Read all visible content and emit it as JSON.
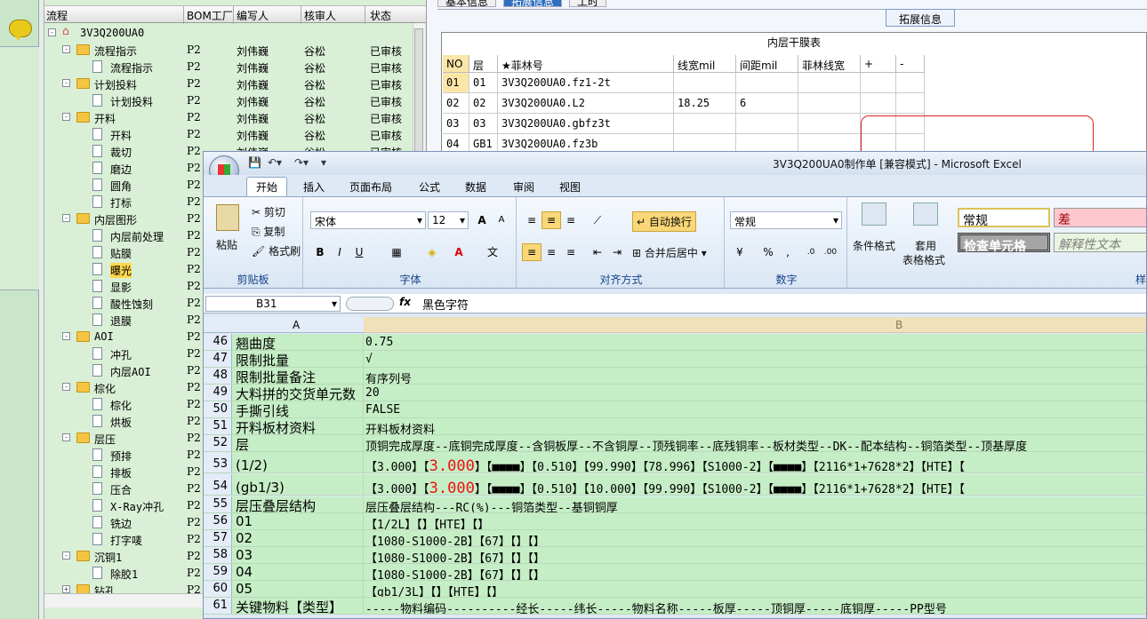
{
  "tree": {
    "headers": [
      "流程",
      "BOM工厂",
      "编写人",
      "核审人",
      "状态"
    ],
    "rows": [
      {
        "indent": 0,
        "type": "root",
        "exp": "-",
        "name": "3V3Q200UA0",
        "plant": "",
        "writer": "",
        "checker": "",
        "status": ""
      },
      {
        "indent": 1,
        "type": "folder",
        "exp": "-",
        "name": "流程指示",
        "plant": "P2",
        "writer": "刘伟巍",
        "checker": "谷松",
        "status": "已审核"
      },
      {
        "indent": 2,
        "type": "doc",
        "exp": "",
        "name": "流程指示",
        "plant": "P2",
        "writer": "刘伟巍",
        "checker": "谷松",
        "status": "已审核"
      },
      {
        "indent": 1,
        "type": "folder",
        "exp": "-",
        "name": "计划投料",
        "plant": "P2",
        "writer": "刘伟巍",
        "checker": "谷松",
        "status": "已审核"
      },
      {
        "indent": 2,
        "type": "doc",
        "exp": "",
        "name": "计划投料",
        "plant": "P2",
        "writer": "刘伟巍",
        "checker": "谷松",
        "status": "已审核"
      },
      {
        "indent": 1,
        "type": "folder",
        "exp": "-",
        "name": "开料",
        "plant": "P2",
        "writer": "刘伟巍",
        "checker": "谷松",
        "status": "已审核"
      },
      {
        "indent": 2,
        "type": "doc",
        "exp": "",
        "name": "开料",
        "plant": "P2",
        "writer": "刘伟巍",
        "checker": "谷松",
        "status": "已审核"
      },
      {
        "indent": 2,
        "type": "doc",
        "exp": "",
        "name": "裁切",
        "plant": "P2",
        "writer": "刘伟巍",
        "checker": "谷松",
        "status": "已审核"
      },
      {
        "indent": 2,
        "type": "doc",
        "exp": "",
        "name": "磨边",
        "plant": "P2",
        "writer": "",
        "checker": "",
        "status": ""
      },
      {
        "indent": 2,
        "type": "doc",
        "exp": "",
        "name": "圆角",
        "plant": "P2",
        "writer": "",
        "checker": "",
        "status": ""
      },
      {
        "indent": 2,
        "type": "doc",
        "exp": "",
        "name": "打标",
        "plant": "P2",
        "writer": "",
        "checker": "",
        "status": ""
      },
      {
        "indent": 1,
        "type": "folder",
        "exp": "-",
        "name": "内层图形",
        "plant": "P2",
        "writer": "",
        "checker": "",
        "status": ""
      },
      {
        "indent": 2,
        "type": "doc",
        "exp": "",
        "name": "内层前处理",
        "plant": "P2",
        "writer": "",
        "checker": "",
        "status": ""
      },
      {
        "indent": 2,
        "type": "doc",
        "exp": "",
        "name": "贴膜",
        "plant": "P2",
        "writer": "",
        "checker": "",
        "status": ""
      },
      {
        "indent": 2,
        "type": "doc",
        "exp": "",
        "name": "曝光",
        "plant": "P2",
        "writer": "",
        "checker": "",
        "status": "",
        "selected": true
      },
      {
        "indent": 2,
        "type": "doc",
        "exp": "",
        "name": "显影",
        "plant": "P2",
        "writer": "",
        "checker": "",
        "status": ""
      },
      {
        "indent": 2,
        "type": "doc",
        "exp": "",
        "name": "酸性蚀刻",
        "plant": "P2",
        "writer": "",
        "checker": "",
        "status": ""
      },
      {
        "indent": 2,
        "type": "doc",
        "exp": "",
        "name": "退膜",
        "plant": "P2",
        "writer": "",
        "checker": "",
        "status": ""
      },
      {
        "indent": 1,
        "type": "folder",
        "exp": "-",
        "name": "AOI",
        "plant": "P2",
        "writer": "",
        "checker": "",
        "status": ""
      },
      {
        "indent": 2,
        "type": "doc",
        "exp": "",
        "name": "冲孔",
        "plant": "P2",
        "writer": "",
        "checker": "",
        "status": ""
      },
      {
        "indent": 2,
        "type": "doc",
        "exp": "",
        "name": "内层AOI",
        "plant": "P2",
        "writer": "",
        "checker": "",
        "status": ""
      },
      {
        "indent": 1,
        "type": "folder",
        "exp": "-",
        "name": "棕化",
        "plant": "P2",
        "writer": "",
        "checker": "",
        "status": ""
      },
      {
        "indent": 2,
        "type": "doc",
        "exp": "",
        "name": "棕化",
        "plant": "P2",
        "writer": "",
        "checker": "",
        "status": ""
      },
      {
        "indent": 2,
        "type": "doc",
        "exp": "",
        "name": "烘板",
        "plant": "P2",
        "writer": "",
        "checker": "",
        "status": ""
      },
      {
        "indent": 1,
        "type": "folder",
        "exp": "-",
        "name": "层压",
        "plant": "P2",
        "writer": "",
        "checker": "",
        "status": ""
      },
      {
        "indent": 2,
        "type": "doc",
        "exp": "",
        "name": "预排",
        "plant": "P2",
        "writer": "",
        "checker": "",
        "status": ""
      },
      {
        "indent": 2,
        "type": "doc",
        "exp": "",
        "name": "排板",
        "plant": "P2",
        "writer": "",
        "checker": "",
        "status": ""
      },
      {
        "indent": 2,
        "type": "doc",
        "exp": "",
        "name": "压合",
        "plant": "P2",
        "writer": "",
        "checker": "",
        "status": ""
      },
      {
        "indent": 2,
        "type": "doc",
        "exp": "",
        "name": "X-Ray冲孔",
        "plant": "P2",
        "writer": "",
        "checker": "",
        "status": ""
      },
      {
        "indent": 2,
        "type": "doc",
        "exp": "",
        "name": "铣边",
        "plant": "P2",
        "writer": "",
        "checker": "",
        "status": ""
      },
      {
        "indent": 2,
        "type": "doc",
        "exp": "",
        "name": "打字唛",
        "plant": "P2",
        "writer": "",
        "checker": "",
        "status": ""
      },
      {
        "indent": 1,
        "type": "folder",
        "exp": "-",
        "name": "沉铜1",
        "plant": "P2",
        "writer": "",
        "checker": "",
        "status": ""
      },
      {
        "indent": 2,
        "type": "doc",
        "exp": "",
        "name": "除胶1",
        "plant": "P2",
        "writer": "",
        "checker": "",
        "status": ""
      },
      {
        "indent": 1,
        "type": "folder",
        "exp": "+",
        "name": "钻孔",
        "plant": "P2",
        "writer": "",
        "checker": "",
        "status": ""
      }
    ]
  },
  "panel": {
    "tabs": [
      "基本信息",
      "拓展信息",
      "工时"
    ],
    "group_button": "拓展信息",
    "table_caption": "内层干膜表",
    "columns": [
      "NO",
      "层",
      "★菲林号",
      "线宽mil",
      "间距mil",
      "菲林线宽",
      "+",
      "-"
    ],
    "rows": [
      [
        "01",
        "01",
        "3V3Q200UA0.fz1-2t",
        "",
        "",
        "",
        "",
        ""
      ],
      [
        "02",
        "02",
        "3V3Q200UA0.L2",
        "18.25",
        "6",
        "",
        "",
        ""
      ],
      [
        "03",
        "03",
        "3V3Q200UA0.gbfz3t",
        "",
        "",
        "",
        "",
        ""
      ],
      [
        "04",
        "GB1",
        "3V3Q200UA0.fz3b",
        "",
        "",
        "",
        "",
        ""
      ]
    ]
  },
  "excel": {
    "window_title": "3V3Q200UA0制作单  [兼容模式] - Microsoft Excel",
    "ribbon_tabs": [
      "开始",
      "插入",
      "页面布局",
      "公式",
      "数据",
      "审阅",
      "视图"
    ],
    "clipboard": {
      "paste": "粘贴",
      "cut": "剪切",
      "copy": "复制",
      "format_painter": "格式刷",
      "label": "剪贴板"
    },
    "font": {
      "name": "宋体",
      "size": "12",
      "label": "字体",
      "grow": "A",
      "shrink": "A"
    },
    "alignment": {
      "wrap": "自动换行",
      "merge": "合并后居中",
      "label": "对齐方式"
    },
    "number": {
      "format": "常规",
      "label": "数字"
    },
    "styles": {
      "conditional": "条件格式",
      "table": "套用",
      "table2": "表格格式",
      "normal": "常规",
      "bad": "差",
      "check": "检查单元格",
      "explain": "解释性文本",
      "label": "样"
    },
    "name_box": "B31",
    "formula_value": "黑色字符",
    "col_a": "A",
    "col_b": "B",
    "rows": [
      {
        "n": "46",
        "a": "翘曲度",
        "b": "0.75"
      },
      {
        "n": "47",
        "a": "限制批量",
        "b": "√"
      },
      {
        "n": "48",
        "a": "限制批量备注",
        "b": "有序列号"
      },
      {
        "n": "49",
        "a": "大料拼的交货单元数",
        "b": "20"
      },
      {
        "n": "50",
        "a": "手撕引线",
        "b": "FALSE"
      },
      {
        "n": "51",
        "a": "开料板材资料",
        "b": "开料板材资料"
      },
      {
        "n": "52",
        "a": "层",
        "b": "顶铜完成厚度--底铜完成厚度--含铜板厚--不含铜厚--顶残铜率--底残铜率--板材类型--DK--配本结构--铜箔类型--顶基厚度"
      },
      {
        "n": "53",
        "a": "(1/2)",
        "b1": "【3.000】【",
        "big": "3.000",
        "b2": "】【■■■■】【0.510】【99.990】【78.996】【S1000-2】【■■■■】【2116*1+7628*2】【HTE】【",
        "tall": true
      },
      {
        "n": "54",
        "a": "(gb1/3)",
        "b1": "【3.000】【",
        "big": "3.000",
        "b2": "】【■■■■】【0.510】【10.000】【99.990】【S1000-2】【■■■■】【2116*1+7628*2】【HTE】【",
        "tall": true
      },
      {
        "n": "55",
        "a": "层压叠层结构",
        "b": "层压叠层结构---RC(%)---铜箔类型--基铜铜厚"
      },
      {
        "n": "56",
        "a": "01",
        "b": "【1/2L】【】【HTE】【】"
      },
      {
        "n": "57",
        "a": "02",
        "b": "【1080-S1000-2B】【67】【】【】"
      },
      {
        "n": "58",
        "a": "03",
        "b": "【1080-S1000-2B】【67】【】【】"
      },
      {
        "n": "59",
        "a": "04",
        "b": "【1080-S1000-2B】【67】【】【】"
      },
      {
        "n": "60",
        "a": "05",
        "b": "【gb1/3L】【】【HTE】【】"
      },
      {
        "n": "61",
        "a": "关键物料【类型】",
        "b": "-----物料编码----------经长-----纬长-----物料名称-----板厚-----顶铜厚-----底铜厚-----PP型号"
      }
    ]
  }
}
